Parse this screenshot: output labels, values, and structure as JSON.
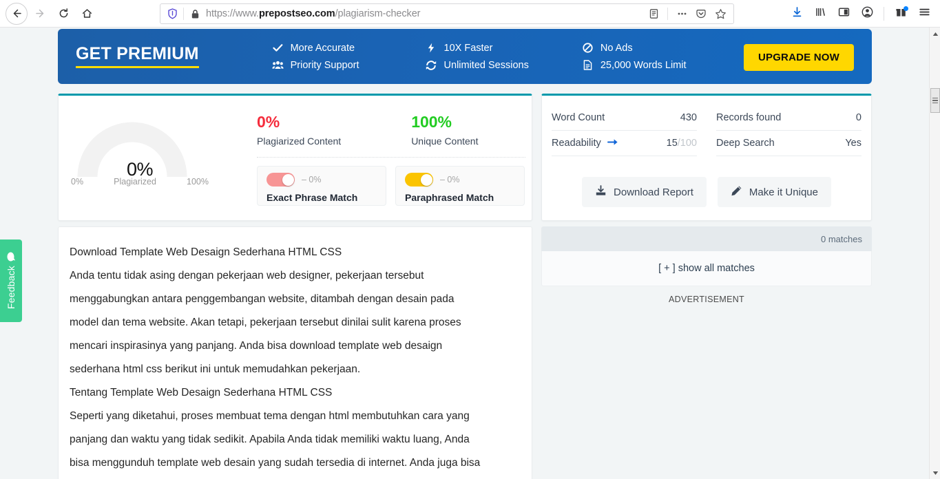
{
  "browser": {
    "url_prefix": "https://www.",
    "url_domain": "prepostseo.com",
    "url_path": "/plagiarism-checker",
    "back_icon": "back-arrow-icon",
    "forward_icon": "forward-arrow-icon",
    "reload_icon": "reload-icon",
    "home_icon": "home-icon",
    "shield_icon": "shield-icon",
    "lock_icon": "lock-icon",
    "reader_icon": "reader-view-icon",
    "ellipsis_icon": "page-actions-icon",
    "pocket_icon": "pocket-icon",
    "bookmark_icon": "star-icon",
    "downloads_icon": "downloads-icon",
    "library_icon": "library-icon",
    "sidebar_icon": "sidebar-icon",
    "account_icon": "account-icon",
    "gift_icon": "gift-icon",
    "menu_icon": "hamburger-menu-icon"
  },
  "feedback": {
    "label": "Feedback",
    "color": "#3ccf91"
  },
  "premium": {
    "title": "GET PREMIUM",
    "accent": "#ffdd00",
    "background": "#1a63b4",
    "features": [
      {
        "label": "More Accurate",
        "icon": "check-icon"
      },
      {
        "label": "Priority Support",
        "icon": "users-icon"
      },
      {
        "label": "10X Faster",
        "icon": "bolt-icon"
      },
      {
        "label": "Unlimited Sessions",
        "icon": "refresh-icon"
      },
      {
        "label": "No Ads",
        "icon": "ban-icon"
      },
      {
        "label": "25,000 Words Limit",
        "icon": "file-text-icon"
      }
    ],
    "upgrade_label": "UPGRADE NOW"
  },
  "results": {
    "accent": "#0099ab",
    "gauge": {
      "value": "0%",
      "caption": "Plagiarized",
      "min_label": "0%",
      "max_label": "100%",
      "track_color": "#f2f2f2"
    },
    "plagiarized": {
      "value": "0%",
      "label": "Plagiarized Content",
      "color": "#f52c3c"
    },
    "unique": {
      "value": "100%",
      "label": "Unique Content",
      "color": "#22cc22"
    },
    "toggles": [
      {
        "name": "Exact Phrase Match",
        "percent": "– 0%",
        "color": "#f79595",
        "state": "on"
      },
      {
        "name": "Paraphrased Match",
        "percent": "– 0%",
        "color": "#fbc400",
        "state": "on"
      }
    ]
  },
  "stats": {
    "left": [
      {
        "label": "Word Count",
        "value": "430",
        "icon": ""
      },
      {
        "label": "Readability",
        "value": "15",
        "value_muted": "/100",
        "icon": "arrow-right-icon"
      }
    ],
    "right": [
      {
        "label": "Records found",
        "value": "0",
        "icon": ""
      },
      {
        "label": "Deep Search",
        "value": "Yes",
        "icon": ""
      }
    ],
    "actions": [
      {
        "label": "Download Report",
        "icon": "download-icon"
      },
      {
        "label": "Make it Unique",
        "icon": "pencil-icon"
      }
    ]
  },
  "matches": {
    "count_label": "0 matches",
    "show_all_label": "[ + ] show all matches",
    "advertisement_label": "ADVERTISEMENT"
  },
  "document": {
    "lines": [
      "Download Template Web Desaign Sederhana HTML CSS",
      "Anda tentu tidak asing dengan pekerjaan web designer, pekerjaan tersebut",
      "menggabungkan antara penggembangan website, ditambah dengan desain pada",
      "model dan tema website.  Akan tetapi, pekerjaan tersebut dinilai sulit karena proses",
      "mencari inspirasinya yang panjang. Anda bisa download template web desaign",
      "sederhana html css berikut ini untuk memudahkan pekerjaan.",
      "Tentang Template Web Desaign Sederhana HTML CSS",
      "Seperti yang diketahui, proses membuat tema dengan html membutuhkan cara yang",
      "panjang dan waktu yang tidak sedikit. Apabila Anda tidak memiliki waktu luang, Anda",
      "bisa menggunduh template web desain yang sudah tersedia di internet. Anda juga bisa"
    ]
  }
}
